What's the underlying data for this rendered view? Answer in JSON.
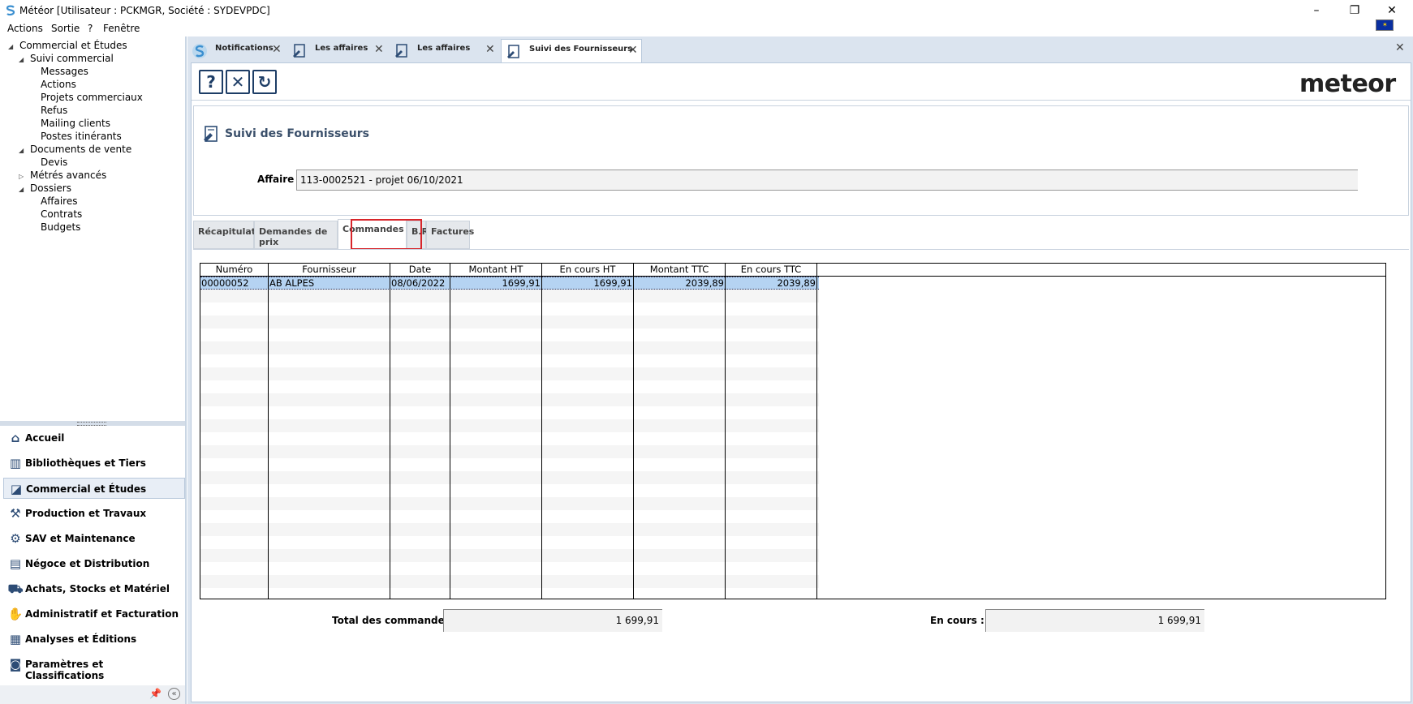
{
  "window": {
    "title": "Météor [Utilisateur : PCKMGR, Société : SYDEVPDC]",
    "minimize": "–",
    "restore": "❐",
    "close": "✕"
  },
  "menu": [
    "Actions",
    "Sortie",
    "?",
    "Fenêtre"
  ],
  "tree": [
    {
      "label": "Commercial et Études",
      "level": 0,
      "toggle": "◢"
    },
    {
      "label": "Suivi commercial",
      "level": 1,
      "toggle": "◢"
    },
    {
      "label": "Messages",
      "level": 2,
      "toggle": ""
    },
    {
      "label": "Actions",
      "level": 2,
      "toggle": ""
    },
    {
      "label": "Projets commerciaux",
      "level": 2,
      "toggle": ""
    },
    {
      "label": "Refus",
      "level": 2,
      "toggle": ""
    },
    {
      "label": "Mailing clients",
      "level": 2,
      "toggle": ""
    },
    {
      "label": "Postes itinérants",
      "level": 2,
      "toggle": ""
    },
    {
      "label": "Documents de vente",
      "level": 1,
      "toggle": "◢"
    },
    {
      "label": "Devis",
      "level": 2,
      "toggle": ""
    },
    {
      "label": "Métrés avancés",
      "level": 1,
      "toggle": "▷"
    },
    {
      "label": "Dossiers",
      "level": 1,
      "toggle": "◢"
    },
    {
      "label": "Affaires",
      "level": 2,
      "toggle": ""
    },
    {
      "label": "Contrats",
      "level": 2,
      "toggle": ""
    },
    {
      "label": "Budgets",
      "level": 2,
      "toggle": ""
    }
  ],
  "nav": [
    {
      "label": "Accueil",
      "icon": "⌂",
      "active": false
    },
    {
      "label": "Bibliothèques et Tiers",
      "icon": "▥",
      "active": false
    },
    {
      "label": "Commercial et Études",
      "icon": "◪",
      "active": true
    },
    {
      "label": "Production et Travaux",
      "icon": "⚒",
      "active": false
    },
    {
      "label": "SAV et Maintenance",
      "icon": "⚙",
      "active": false
    },
    {
      "label": "Négoce et Distribution",
      "icon": "▤",
      "active": false
    },
    {
      "label": "Achats, Stocks et Matériel",
      "icon": "⛟",
      "active": false
    },
    {
      "label": "Administratif et Facturation",
      "icon": "✋",
      "active": false
    },
    {
      "label": "Analyses et Éditions",
      "icon": "▦",
      "active": false
    },
    {
      "label": "Paramètres et Classifications",
      "icon": "◙",
      "active": false
    }
  ],
  "pin_icon": "📌",
  "collapse_icon": "«",
  "doc_tabs": [
    {
      "label": "Notifications",
      "active": false
    },
    {
      "label": "Les affaires",
      "active": false
    },
    {
      "label": "Les affaires",
      "active": false
    },
    {
      "label": "Suivi des Fournisseurs",
      "active": true
    }
  ],
  "close_glyph": "✕",
  "toolbar": {
    "help": "?",
    "close": "✕",
    "refresh": "↻"
  },
  "logo": {
    "text": "meteor",
    "mark": "S"
  },
  "form": {
    "title": "Suivi des Fournisseurs",
    "affaire_label": "Affaire :",
    "affaire_value": "113-0002521 - projet 06/10/2021"
  },
  "sub_tabs": [
    "Récapitulatif",
    "Demandes de prix",
    "Commandes",
    "B.R.",
    "Factures"
  ],
  "active_sub_tab": "Commandes",
  "grid": {
    "columns": [
      "Numéro",
      "Fournisseur",
      "Date",
      "Montant HT",
      "En cours HT",
      "Montant TTC",
      "En cours TTC"
    ],
    "rows": [
      [
        "00000052",
        "AB ALPES",
        "08/06/2022",
        "1699,91",
        "1699,91",
        "2039,89",
        "2039,89"
      ]
    ]
  },
  "totals": {
    "total_label": "Total des commandes :",
    "total_value": "1 699,91",
    "encours_label": "En cours :",
    "encours_value": "1 699,91"
  },
  "colors": {
    "accent": "#1d3d66",
    "highlight": "#d7252b",
    "selection": "#b5d3f2"
  }
}
